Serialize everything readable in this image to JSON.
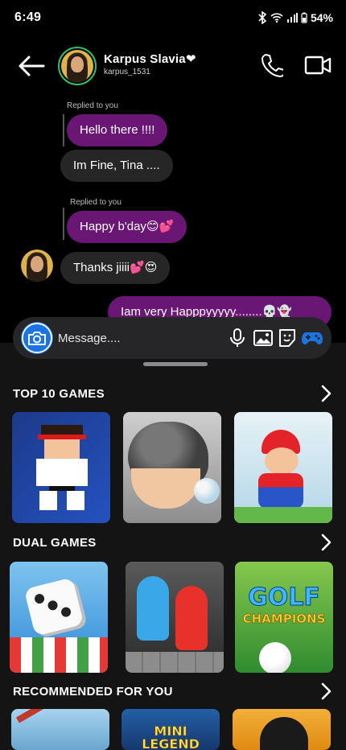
{
  "status": {
    "time": "6:49",
    "battery": "54%"
  },
  "contact": {
    "name": "Karpus Slavia❤",
    "username": "karpus_1531"
  },
  "messages": [
    {
      "reply_label": "Replied to you",
      "text": "Hello there !!!!",
      "side": "sent"
    },
    {
      "text": "Im Fine, Tina ....",
      "side": "received"
    },
    {
      "reply_label": "Replied to you",
      "text": "Happy b'day😊💕",
      "side": "sent"
    },
    {
      "text": "Thanks jiiii💕😍",
      "side": "received"
    },
    {
      "text": "Iam very Happpyyyyy........💀👻",
      "side": "sent"
    }
  ],
  "composer": {
    "placeholder": "Message...."
  },
  "sections": {
    "top_games": {
      "title": "TOP 10 GAMES"
    },
    "dual_games": {
      "title": "DUAL GAMES"
    },
    "recommended": {
      "title": "RECOMMENDED FOR YOU"
    }
  },
  "game_tiles": {
    "golf_title": "GOLF",
    "golf_subtitle": "CHAMPIONS",
    "mini_legend_line1": "MINI",
    "mini_legend_line2": "LEGEND"
  },
  "colors": {
    "sent_bubble": "#6a1675",
    "received_bubble": "#262626",
    "accent": "#1b74e4",
    "online_ring": "#2fbf6a"
  }
}
